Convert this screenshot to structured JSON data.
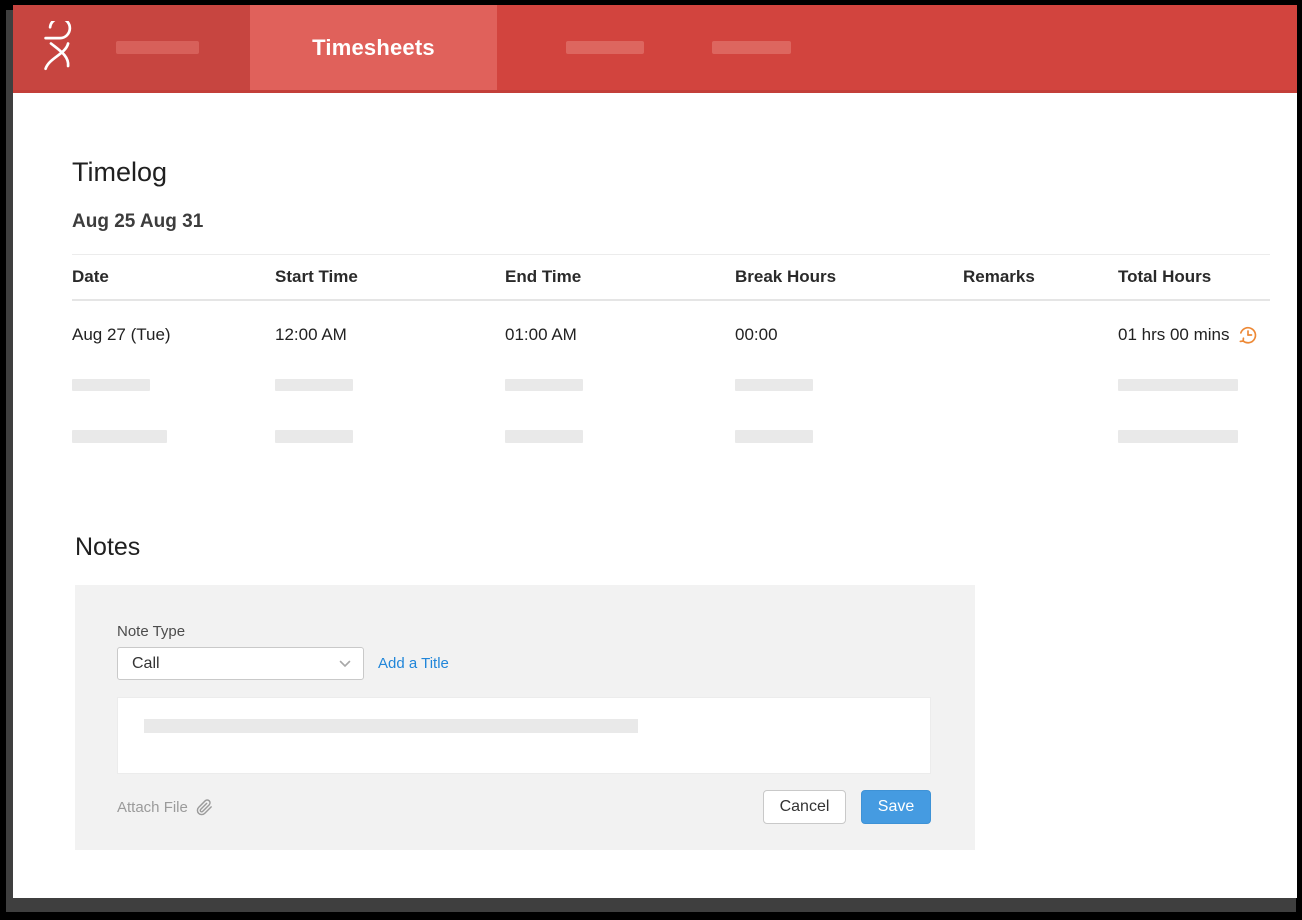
{
  "header": {
    "tab_label": "Timesheets",
    "colors": {
      "bar": "#d2443e",
      "brand_block": "#c74540",
      "active_tab": "#e0615b"
    }
  },
  "timelog": {
    "title": "Timelog",
    "date_range": "Aug 25 Aug 31",
    "columns": [
      "Date",
      "Start Time",
      "End Time",
      "Break Hours",
      "Remarks",
      "Total Hours"
    ],
    "rows": [
      {
        "date": "Aug 27 (Tue)",
        "start_time": "12:00 AM",
        "end_time": "01:00 AM",
        "break_hours": "00:00",
        "remarks": "",
        "total_hours": "01 hrs 00 mins"
      }
    ],
    "icons": {
      "total_hours": "history-clock-icon",
      "icon_color": "#ed8936"
    }
  },
  "notes": {
    "title": "Notes",
    "note_type_label": "Note Type",
    "note_type_value": "Call",
    "add_title_link": "Add a Title",
    "attach_file_label": "Attach File",
    "cancel_label": "Cancel",
    "save_label": "Save",
    "accent_link_color": "#2186d9",
    "save_button_color": "#459be1"
  }
}
